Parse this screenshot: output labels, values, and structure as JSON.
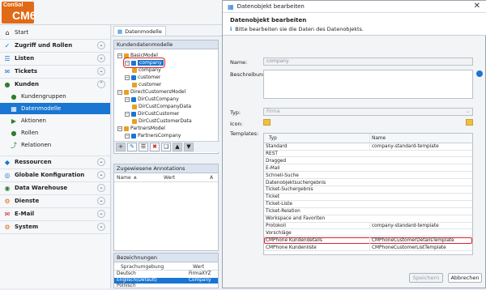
{
  "app": {
    "logo_top": "ConSol",
    "logo_main": "CM6"
  },
  "sidebar": {
    "start": "Start",
    "sections": [
      {
        "label": "Zugriff und Rollen"
      },
      {
        "label": "Listen"
      },
      {
        "label": "Tickets"
      },
      {
        "label": "Kunden"
      }
    ],
    "kunden_items": [
      "Kundengruppen",
      "Datenmodelle",
      "Aktionen",
      "Rollen",
      "Relationen"
    ],
    "bottom_sections": [
      "Ressourcen",
      "Globale Konfiguration",
      "Data Warehouse",
      "Dienste",
      "E-Mail",
      "System"
    ]
  },
  "main": {
    "tab_label": "Datenmodelle",
    "models_header": "Kundendatenmodelle",
    "tree": [
      {
        "label": "BasicModel",
        "depth": 0
      },
      {
        "label": "company",
        "depth": 1,
        "selected": true
      },
      {
        "label": "company",
        "depth": 2
      },
      {
        "label": "customer",
        "depth": 1
      },
      {
        "label": "customer",
        "depth": 2
      },
      {
        "label": "DirectCustomersModel",
        "depth": 0
      },
      {
        "label": "DirCustCompany",
        "depth": 1
      },
      {
        "label": "DirCustCompanyData",
        "depth": 2
      },
      {
        "label": "DirCustCustomer",
        "depth": 1
      },
      {
        "label": "DirCustCustomerData",
        "depth": 2
      },
      {
        "label": "PartnersModel",
        "depth": 0
      },
      {
        "label": "PartnersCompany",
        "depth": 1
      }
    ],
    "annotations_header": "Zugewiesene Annotations",
    "annotations_cols": [
      "Name",
      "Wert",
      "A"
    ],
    "labels_header": "Bezeichnungen",
    "labels_cols": [
      "Sprachumgebung",
      "Wert"
    ],
    "labels_rows": [
      {
        "lang": "Deutsch",
        "value": "FirmaXYZ",
        "selected": false
      },
      {
        "lang": "Englisch(Default)",
        "value": "Company",
        "selected": true
      },
      {
        "lang": "Polnisch",
        "value": "",
        "selected": false
      }
    ]
  },
  "dialog": {
    "title": "Datenobjekt bearbeiten",
    "heading": "Datenobjekt bearbeiten",
    "info": "Bitte bearbeiten sie die Daten des Datenobjekts.",
    "name_label": "Name:",
    "name_value": "company",
    "desc_label": "Beschreibung:",
    "typ_label": "Typ:",
    "typ_value": "Firma",
    "icon_label": "Icon:",
    "templates_label": "Templates:",
    "templates_cols": [
      "Typ",
      "Name"
    ],
    "templates_rows": [
      {
        "typ": "Standard",
        "name": "company-standard-template"
      },
      {
        "typ": "REST",
        "name": ""
      },
      {
        "typ": "Dragged",
        "name": ""
      },
      {
        "typ": "E-Mail",
        "name": ""
      },
      {
        "typ": "Schnell-Suche",
        "name": ""
      },
      {
        "typ": "Datenobjektsuchergebnis",
        "name": ""
      },
      {
        "typ": "Ticket-Suchergebnis",
        "name": ""
      },
      {
        "typ": "Ticket",
        "name": ""
      },
      {
        "typ": "Ticket-Liste",
        "name": ""
      },
      {
        "typ": "Ticket-Relation",
        "name": ""
      },
      {
        "typ": "Workspace and Favoriten",
        "name": ""
      },
      {
        "typ": "Protokoll",
        "name": "company-standard-template"
      },
      {
        "typ": "Vorschläge",
        "name": ""
      },
      {
        "typ": "CMPhone Kundendetails",
        "name": "CMPhoneCustomerDetailsTemplate",
        "highlight": true
      },
      {
        "typ": "CMPhone Kundenliste",
        "name": "CMPhoneCustomerListTemplate"
      }
    ],
    "save_label": "Speichern",
    "cancel_label": "Abbrechen"
  },
  "colors": {
    "accent": "#1976d2",
    "highlight": "#e0202a",
    "logo": "#e06a16"
  }
}
